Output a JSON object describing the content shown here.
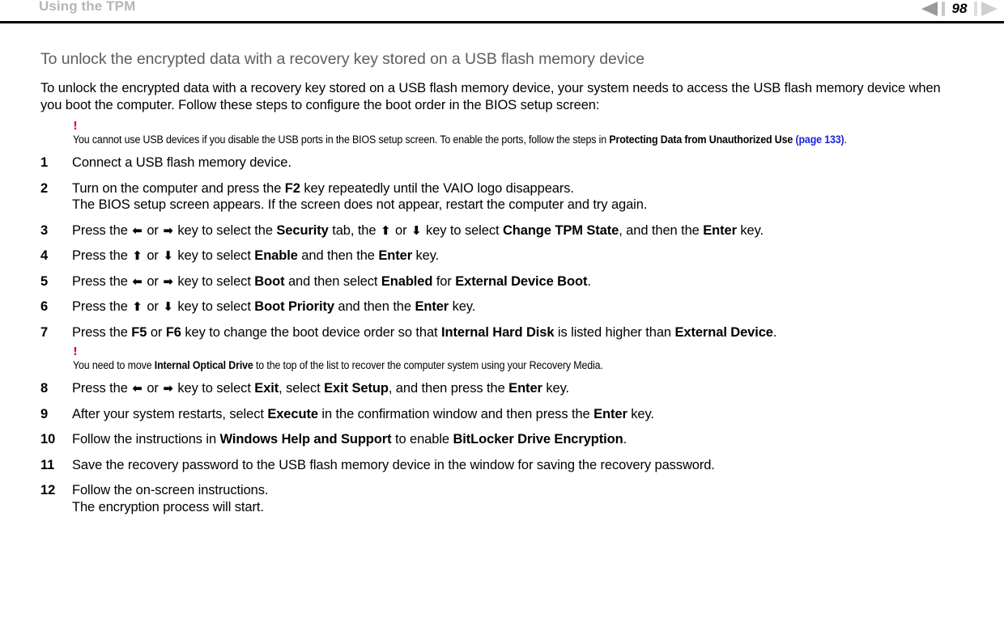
{
  "header": {
    "title": "Using the TPM",
    "page_number": "98",
    "prev_icon": "left-triangle-icon",
    "next_icon": "right-triangle-icon"
  },
  "main": {
    "heading": "To unlock the encrypted data with a recovery key stored on a USB flash memory device",
    "intro": "To unlock the encrypted data with a recovery key stored on a USB flash memory device, your system needs to access the USB flash memory device when you boot the computer. Follow these steps to configure the boot order in the BIOS setup screen:",
    "note_1": {
      "bang": "!",
      "part_1": "You cannot use USB devices if you disable the USB ports in the BIOS setup screen. To enable the ports, follow the steps in ",
      "bold_1": "Protecting Data from Unauthorized Use",
      "link": "(page 133)",
      "part_2": "."
    },
    "note_2": {
      "bang": "!",
      "part_1": "You need to move ",
      "bold_1": "Internal Optical Drive",
      "part_2": " to the top of the list to recover the computer system using your Recovery Media."
    },
    "steps": [
      {
        "num": "1",
        "segments": [
          {
            "text": "Connect a USB flash memory device.",
            "bold": false
          }
        ]
      },
      {
        "num": "2",
        "segments": [
          {
            "text": "Turn on the computer and press the ",
            "bold": false
          },
          {
            "text": "F2",
            "bold": true
          },
          {
            "text": " key repeatedly until the VAIO logo disappears.",
            "bold": false
          }
        ],
        "sub_line": "The BIOS setup screen appears. If the screen does not appear, restart the computer and try again."
      },
      {
        "num": "3",
        "segments": [
          {
            "text": "Press the ",
            "bold": false
          },
          {
            "text": "⬅",
            "arrow": true
          },
          {
            "text": " or ",
            "bold": false
          },
          {
            "text": "➡",
            "arrow": true
          },
          {
            "text": " key to select the ",
            "bold": false
          },
          {
            "text": "Security",
            "bold": true
          },
          {
            "text": " tab, the ",
            "bold": false
          },
          {
            "text": "⬆",
            "arrow": true
          },
          {
            "text": " or ",
            "bold": false
          },
          {
            "text": "⬇",
            "arrow": true
          },
          {
            "text": " key to select ",
            "bold": false
          },
          {
            "text": "Change TPM State",
            "bold": true
          },
          {
            "text": ", and then the ",
            "bold": false
          },
          {
            "text": "Enter",
            "bold": true
          },
          {
            "text": " key.",
            "bold": false
          }
        ]
      },
      {
        "num": "4",
        "segments": [
          {
            "text": "Press the ",
            "bold": false
          },
          {
            "text": "⬆",
            "arrow": true
          },
          {
            "text": " or ",
            "bold": false
          },
          {
            "text": "⬇",
            "arrow": true
          },
          {
            "text": " key to select ",
            "bold": false
          },
          {
            "text": "Enable",
            "bold": true
          },
          {
            "text": " and then the ",
            "bold": false
          },
          {
            "text": "Enter",
            "bold": true
          },
          {
            "text": " key.",
            "bold": false
          }
        ]
      },
      {
        "num": "5",
        "segments": [
          {
            "text": "Press the ",
            "bold": false
          },
          {
            "text": "⬅",
            "arrow": true
          },
          {
            "text": " or ",
            "bold": false
          },
          {
            "text": "➡",
            "arrow": true
          },
          {
            "text": " key to select ",
            "bold": false
          },
          {
            "text": "Boot",
            "bold": true
          },
          {
            "text": " and then select ",
            "bold": false
          },
          {
            "text": "Enabled",
            "bold": true
          },
          {
            "text": " for ",
            "bold": false
          },
          {
            "text": "External Device Boot",
            "bold": true
          },
          {
            "text": ".",
            "bold": false
          }
        ]
      },
      {
        "num": "6",
        "segments": [
          {
            "text": "Press the ",
            "bold": false
          },
          {
            "text": "⬆",
            "arrow": true
          },
          {
            "text": " or ",
            "bold": false
          },
          {
            "text": "⬇",
            "arrow": true
          },
          {
            "text": " key to select ",
            "bold": false
          },
          {
            "text": "Boot Priority",
            "bold": true
          },
          {
            "text": " and then the ",
            "bold": false
          },
          {
            "text": "Enter",
            "bold": true
          },
          {
            "text": " key.",
            "bold": false
          }
        ]
      },
      {
        "num": "7",
        "segments": [
          {
            "text": "Press the ",
            "bold": false
          },
          {
            "text": "F5",
            "bold": true
          },
          {
            "text": " or ",
            "bold": false
          },
          {
            "text": "F6",
            "bold": true
          },
          {
            "text": " key to change the boot device order so that ",
            "bold": false
          },
          {
            "text": "Internal Hard Disk",
            "bold": true
          },
          {
            "text": " is listed higher than ",
            "bold": false
          },
          {
            "text": "External Device",
            "bold": true
          },
          {
            "text": ".",
            "bold": false
          }
        ]
      },
      {
        "num": "8",
        "segments": [
          {
            "text": "Press the ",
            "bold": false
          },
          {
            "text": "⬅",
            "arrow": true
          },
          {
            "text": " or ",
            "bold": false
          },
          {
            "text": "➡",
            "arrow": true
          },
          {
            "text": " key to select ",
            "bold": false
          },
          {
            "text": "Exit",
            "bold": true
          },
          {
            "text": ", select ",
            "bold": false
          },
          {
            "text": "Exit Setup",
            "bold": true
          },
          {
            "text": ", and then press the ",
            "bold": false
          },
          {
            "text": "Enter",
            "bold": true
          },
          {
            "text": " key.",
            "bold": false
          }
        ]
      },
      {
        "num": "9",
        "segments": [
          {
            "text": "After your system restarts, select ",
            "bold": false
          },
          {
            "text": "Execute",
            "bold": true
          },
          {
            "text": " in the confirmation window and then press the ",
            "bold": false
          },
          {
            "text": "Enter",
            "bold": true
          },
          {
            "text": " key.",
            "bold": false
          }
        ]
      },
      {
        "num": "10",
        "segments": [
          {
            "text": "Follow the instructions in ",
            "bold": false
          },
          {
            "text": "Windows Help and Support",
            "bold": true
          },
          {
            "text": " to enable ",
            "bold": false
          },
          {
            "text": "BitLocker Drive Encryption",
            "bold": true
          },
          {
            "text": ".",
            "bold": false
          }
        ]
      },
      {
        "num": "11",
        "segments": [
          {
            "text": "Save the recovery password to the USB flash memory device in the window for saving the recovery password.",
            "bold": false
          }
        ]
      },
      {
        "num": "12",
        "segments": [
          {
            "text": "Follow the on-screen instructions.",
            "bold": false
          }
        ],
        "sub_line": "The encryption process will start."
      }
    ]
  },
  "colors": {
    "header_title": "#b6b6b6",
    "heading": "#5e5e5e",
    "link": "#1a22d8",
    "caution": "#e1001a",
    "rule": "#000000"
  }
}
